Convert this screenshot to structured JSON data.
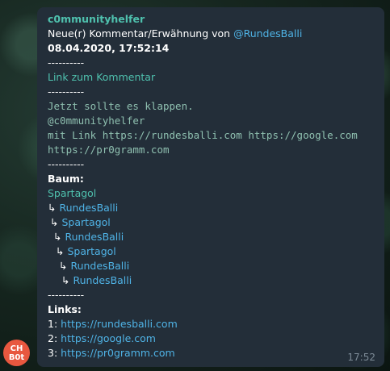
{
  "avatar": {
    "line1": "CH",
    "line2": "B0t"
  },
  "message": {
    "sender": "c0mmunityhelfer",
    "heading_prefix": "Neue(r) Kommentar/Erwähnung von ",
    "heading_user": "@RundesBalli",
    "datetime": "08.04.2020, 17:52:14",
    "separator": "----------",
    "comment_link": "Link zum Kommentar",
    "code_lines": [
      "Jetzt sollte es klappen.",
      "@c0mmunityhelfer",
      "mit Link https://rundesballi.com https://google.com",
      "https://pr0gramm.com"
    ],
    "tree_label": "Baum:",
    "tree_arrow": "↳",
    "tree": [
      "Spartagol",
      "RundesBalli",
      "Spartagol",
      "RundesBalli",
      "Spartagol",
      "RundesBalli",
      "RundesBalli"
    ],
    "links_label": "Links:",
    "links": [
      {
        "num": "1: ",
        "url": "https://rundesballi.com"
      },
      {
        "num": "2: ",
        "url": "https://google.com"
      },
      {
        "num": "3: ",
        "url": "https://pr0gramm.com"
      }
    ],
    "time": "17:52"
  }
}
